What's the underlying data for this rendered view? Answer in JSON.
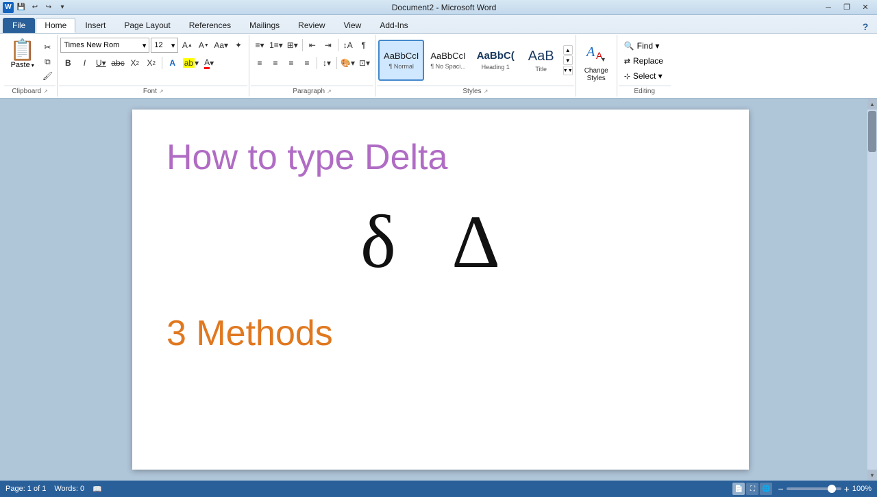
{
  "titlebar": {
    "app_icon": "W",
    "title": "Document2 - Microsoft Word",
    "quick_access": [
      "save",
      "undo",
      "redo",
      "customize"
    ],
    "win_buttons": [
      "minimize",
      "restore",
      "close"
    ]
  },
  "ribbon": {
    "tabs": [
      {
        "id": "file",
        "label": "File",
        "active": false
      },
      {
        "id": "home",
        "label": "Home",
        "active": true
      },
      {
        "id": "insert",
        "label": "Insert",
        "active": false
      },
      {
        "id": "page_layout",
        "label": "Page Layout",
        "active": false
      },
      {
        "id": "references",
        "label": "References",
        "active": false
      },
      {
        "id": "mailings",
        "label": "Mailings",
        "active": false
      },
      {
        "id": "review",
        "label": "Review",
        "active": false
      },
      {
        "id": "view",
        "label": "View",
        "active": false
      },
      {
        "id": "add_ins",
        "label": "Add-Ins",
        "active": false
      }
    ],
    "groups": {
      "clipboard": {
        "label": "Clipboard",
        "paste_label": "Paste",
        "buttons": [
          "cut",
          "copy",
          "format-painter"
        ]
      },
      "font": {
        "label": "Font",
        "font_name": "Times New Rom",
        "font_size": "12",
        "buttons_row1": [
          "grow-font",
          "shrink-font",
          "change-case",
          "clear-format"
        ],
        "buttons_row2": [
          "bold",
          "italic",
          "underline",
          "strikethrough",
          "subscript",
          "superscript",
          "text-effects",
          "text-highlight",
          "font-color"
        ]
      },
      "paragraph": {
        "label": "Paragraph",
        "buttons_row1": [
          "bullets",
          "numbering",
          "multilevel",
          "decrease-indent",
          "increase-indent",
          "sort",
          "show-formatting"
        ],
        "buttons_row2": [
          "align-left",
          "align-center",
          "align-right",
          "justify",
          "line-spacing",
          "shading",
          "border"
        ]
      },
      "styles": {
        "label": "Styles",
        "items": [
          {
            "id": "normal",
            "preview": "AaBbCcI",
            "label": "¶ Normal",
            "active": true
          },
          {
            "id": "no_spacing",
            "preview": "AaBbCcI",
            "label": "¶ No Spaci..."
          },
          {
            "id": "heading1",
            "preview": "AaBbC(",
            "label": "Heading 1"
          },
          {
            "id": "title",
            "preview": "AaB",
            "label": "Title"
          }
        ]
      },
      "change_styles": {
        "label": "Change Styles",
        "icon": "A"
      },
      "editing": {
        "label": "Editing",
        "buttons": [
          {
            "id": "find",
            "label": "Find",
            "icon": "🔍"
          },
          {
            "id": "replace",
            "label": "Replace",
            "icon": ""
          },
          {
            "id": "select",
            "label": "Select ▾",
            "icon": ""
          }
        ]
      }
    }
  },
  "document": {
    "title": "How to type Delta",
    "delta_symbols": "δ  Δ",
    "methods": "3 Methods"
  },
  "statusbar": {
    "page_info": "Page: 1 of 1",
    "words": "Words: 0",
    "zoom": "100%",
    "zoom_value": 100
  }
}
